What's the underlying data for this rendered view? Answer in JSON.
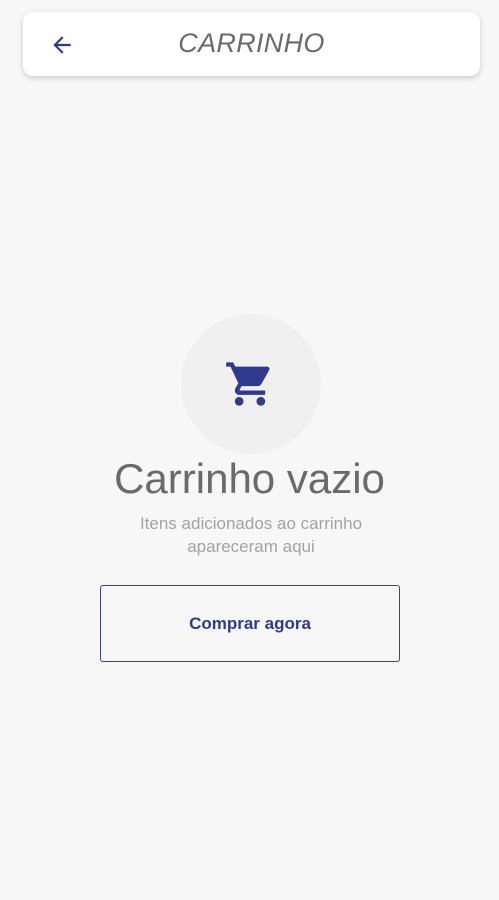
{
  "header": {
    "title": "CARRINHO",
    "back_icon": "arrow-left-icon"
  },
  "empty_state": {
    "icon": "shopping-cart-icon",
    "title": "Carrinho vazio",
    "subtitle_line1": "Itens adicionados ao carrinho",
    "subtitle_line2": "apareceram aqui",
    "button_label": "Comprar agora"
  },
  "colors": {
    "accent": "#2f3a8f",
    "background": "#f7f7f7",
    "header_bg": "#ffffff",
    "text_muted": "#a3a3a3"
  }
}
